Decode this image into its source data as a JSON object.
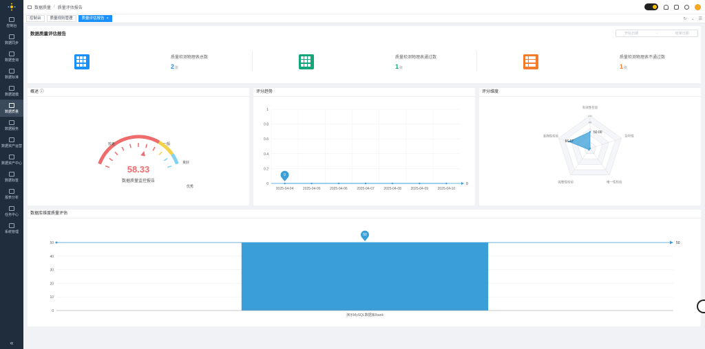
{
  "sidebar": {
    "items": [
      {
        "label": "控制台"
      },
      {
        "label": "数据同步"
      },
      {
        "label": "数据查询"
      },
      {
        "label": "数据标准"
      },
      {
        "label": "数据建模"
      },
      {
        "label": "数据质量"
      },
      {
        "label": "数据服务"
      },
      {
        "label": "数据资产运营"
      },
      {
        "label": "数据资产中心"
      },
      {
        "label": "数据标签"
      },
      {
        "label": "报表分析"
      },
      {
        "label": "任务中心"
      },
      {
        "label": "系统管理"
      }
    ],
    "active_index": 5,
    "collapse_icon": "«"
  },
  "topbar": {
    "breadcrumb": [
      "数据质量",
      "质量评估报告"
    ],
    "icons": [
      "theme-toggle",
      "bell-icon",
      "fullscreen-icon",
      "translate-icon",
      "user-avatar"
    ]
  },
  "tabs": [
    {
      "label": "控制台"
    },
    {
      "label": "质量规则管理"
    },
    {
      "label": "质量评估报告",
      "active": true,
      "close": "×"
    }
  ],
  "tab_tools": [
    "↻",
    "⌄",
    "☰"
  ],
  "page": {
    "title": "数据质量评估报告",
    "date_start_placeholder": "开始日期",
    "date_sep": "→",
    "date_end_placeholder": "结束日期"
  },
  "stats": [
    {
      "label": "质量检测物理表总数",
      "value": "2",
      "unit": "张",
      "color": "#1890ff"
    },
    {
      "label": "质量检测物理表通过数",
      "value": "1",
      "unit": "张",
      "color": "#13a57a"
    },
    {
      "label": "质量检测物理表不通过数",
      "value": "1",
      "unit": "张",
      "color": "#f47c2a"
    }
  ],
  "overview": {
    "title": "概述 ⓘ",
    "score": "58.33",
    "subtitle": "数据质量监控报告",
    "gauge_labels": [
      "较差",
      "一般",
      "良好",
      "优秀"
    ],
    "score_value": 58.33,
    "score_max": 100
  },
  "trend": {
    "title": "评分趋势",
    "chart_data": {
      "type": "line",
      "x": [
        "2025-04-04",
        "2025-04-05",
        "2025-04-06",
        "2025-04-07",
        "2025-04-08",
        "2025-04-09",
        "2025-04-10"
      ],
      "series": [
        {
          "values": [
            0,
            0,
            0,
            0,
            0,
            0,
            0
          ]
        }
      ],
      "ylim": [
        0,
        1
      ],
      "yticks": [
        "0",
        "0.2",
        "0.4",
        "0.6",
        "0.8",
        "1"
      ],
      "marker": "0",
      "end_label": "0"
    }
  },
  "dimension": {
    "title": "评分维度",
    "chart_data": {
      "type": "radar",
      "indicators": [
        "有效性检验",
        "及时性",
        "唯一性检验",
        "完整性检验",
        "准确性检验"
      ],
      "max_label": "100",
      "tick_label": "80",
      "values": [
        50,
        0,
        0,
        5,
        66.67
      ],
      "value_labels": [
        "50.00",
        "66.67"
      ]
    }
  },
  "bar": {
    "title": "数据库维度质量评估",
    "chart_data": {
      "type": "bar",
      "categories": [
        "演示MySQL数据库/bank"
      ],
      "values": [
        50
      ],
      "ylim": [
        0,
        50
      ],
      "yticks": [
        "0",
        "10",
        "20",
        "30",
        "40",
        "50"
      ],
      "marker": "50",
      "markline_label": "50",
      "color": "#3a9fd8"
    }
  }
}
